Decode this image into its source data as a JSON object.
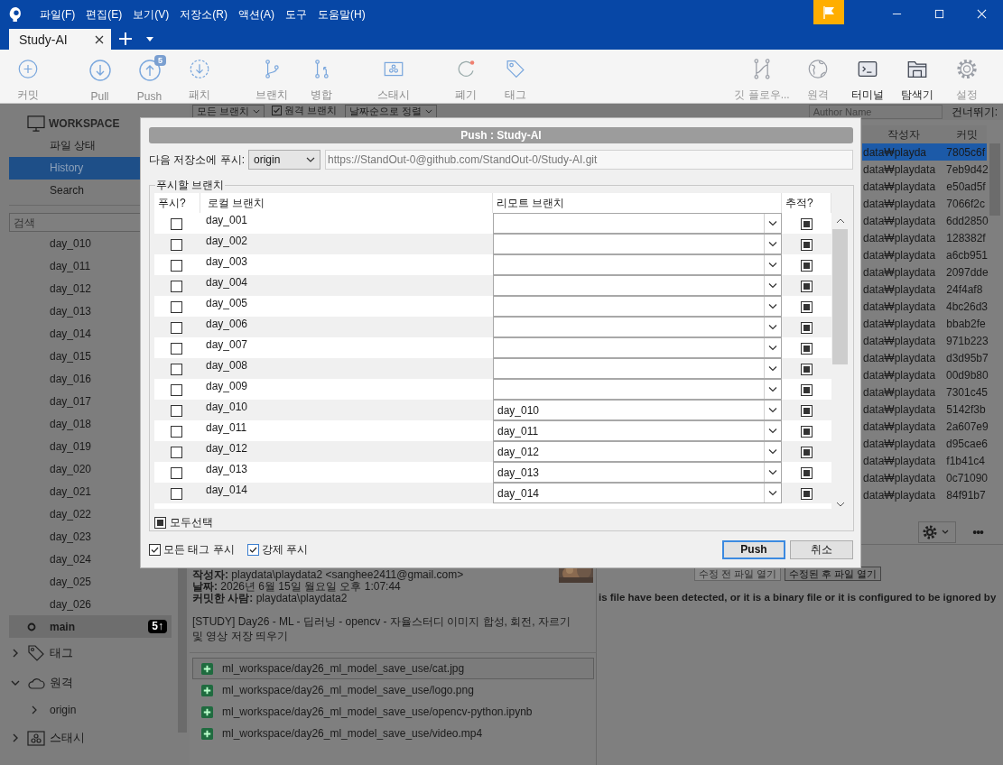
{
  "window": {
    "menus": [
      "파일(F)",
      "편집(E)",
      "보기(V)",
      "저장소(R)",
      "액션(A)",
      "도구",
      "도움말(H)"
    ]
  },
  "tabs": [
    {
      "label": "Study-AI",
      "selected": true
    }
  ],
  "toolbar": {
    "tools": [
      {
        "kind": "add",
        "label": "커밋"
      },
      {
        "kind": "pull",
        "label": "Pull"
      },
      {
        "kind": "push",
        "label": "Push",
        "badge": "5"
      },
      {
        "kind": "patch",
        "label": "패치"
      },
      {
        "kind": "branch",
        "label": "브랜치"
      },
      {
        "kind": "merge",
        "label": "병합"
      },
      {
        "kind": "stash",
        "label": "스태시"
      },
      {
        "kind": "discard",
        "label": "폐기"
      },
      {
        "kind": "tag",
        "label": "태그"
      }
    ],
    "right_tools": [
      {
        "kind": "flow",
        "label": "깃 플로우...",
        "disabled": true
      },
      {
        "kind": "globe",
        "label": "원격",
        "disabled": true
      },
      {
        "kind": "terminal",
        "label": "터미널",
        "disabled": false
      },
      {
        "kind": "folder",
        "label": "탐색기",
        "disabled": false
      },
      {
        "kind": "gear",
        "label": "설정",
        "disabled": true
      }
    ]
  },
  "sidebar": {
    "workspace": "WORKSPACE",
    "views": [
      {
        "label": "파일 상태",
        "selected": false
      },
      {
        "label": "History",
        "selected": true
      },
      {
        "label": "Search",
        "selected": false
      }
    ],
    "search": {
      "placeholder": "검색"
    },
    "branches": [
      {
        "label": "day_010",
        "selected": false
      },
      {
        "label": "day_011",
        "selected": false
      },
      {
        "label": "day_012",
        "selected": false
      },
      {
        "label": "day_013",
        "selected": false
      },
      {
        "label": "day_014",
        "selected": false
      },
      {
        "label": "day_015",
        "selected": false
      },
      {
        "label": "day_016",
        "selected": false
      },
      {
        "label": "day_017",
        "selected": false
      },
      {
        "label": "day_018",
        "selected": false
      },
      {
        "label": "day_019",
        "selected": false
      },
      {
        "label": "day_020",
        "selected": false
      },
      {
        "label": "day_021",
        "selected": false
      },
      {
        "label": "day_022",
        "selected": false
      },
      {
        "label": "day_023",
        "selected": false
      },
      {
        "label": "day_024",
        "selected": false
      },
      {
        "label": "day_025",
        "selected": false
      },
      {
        "label": "day_026",
        "selected": false
      },
      {
        "label": "main",
        "selected": true,
        "badge": "5↑"
      }
    ],
    "sections": [
      {
        "kind": "tag",
        "label": "태그",
        "expanded": false
      },
      {
        "kind": "cloud",
        "label": "원격",
        "expanded": true,
        "children": [
          {
            "label": "origin",
            "expanded": false
          }
        ]
      },
      {
        "kind": "stash",
        "label": "스태시",
        "expanded": false
      }
    ]
  },
  "filters": {
    "branch_select": "모든 브랜치",
    "remote_branches": {
      "label": "원격 브랜치",
      "checked": true
    },
    "sort_select": "날짜순으로 정렬",
    "author": {
      "placeholder": "Author Name"
    },
    "skip_label": "건너뛰기:"
  },
  "commits": {
    "columns": [
      "작성자",
      "커밋"
    ],
    "rows": [
      {
        "author": "data₩playda",
        "hash": "7805c6f",
        "selected": true
      },
      {
        "author": "data₩playdata",
        "hash": "7eb9d42",
        "selected": false
      },
      {
        "author": "data₩playdata",
        "hash": "e50ad5f",
        "selected": false
      },
      {
        "author": "data₩playdata",
        "hash": "7066f2c",
        "selected": false
      },
      {
        "author": "data₩playdata",
        "hash": "6dd2850",
        "selected": false
      },
      {
        "author": "data₩playdata",
        "hash": "128382f",
        "selected": false
      },
      {
        "author": "data₩playdata",
        "hash": "a6cb951",
        "selected": false
      },
      {
        "author": "data₩playdata",
        "hash": "2097dde",
        "selected": false
      },
      {
        "author": "data₩playdata",
        "hash": "24f4af8",
        "selected": false
      },
      {
        "author": "data₩playdata",
        "hash": "4bc26d3",
        "selected": false
      },
      {
        "author": "data₩playdata",
        "hash": "bbab2fe",
        "selected": false
      },
      {
        "author": "data₩playdata",
        "hash": "971b223",
        "selected": false
      },
      {
        "author": "data₩playdata",
        "hash": "d3d95b7",
        "selected": false
      },
      {
        "author": "data₩playdata",
        "hash": "00d9b80",
        "selected": false
      },
      {
        "author": "data₩playdata",
        "hash": "7301c45",
        "selected": false
      },
      {
        "author": "data₩playdata",
        "hash": "5142f3b",
        "selected": false
      },
      {
        "author": "data₩playdata",
        "hash": "2a607e9",
        "selected": false
      },
      {
        "author": "data₩playdata",
        "hash": "d95cae6",
        "selected": false
      },
      {
        "author": "data₩playdata",
        "hash": "f1b41c4",
        "selected": false
      },
      {
        "author": "data₩playdata",
        "hash": "0c71090",
        "selected": false
      },
      {
        "author": "data₩playdata",
        "hash": "84f91b7",
        "selected": false
      }
    ]
  },
  "details": {
    "lines": [
      "**작성자:** playdata\\playdata2 <sanghee2411@gmail.com>",
      "**날짜:** 2026년 6월 15일 월요일 오후 1:07:44",
      "**커밋한 사람:** playdata\\playdata2"
    ],
    "message": "[STUDY] Day26 - ML - 딥러닝 - opencv - 자율스터디 이미지 합성, 회전, 자르기 및 영상 저장 띄우기",
    "files": [
      {
        "path": "ml_workspace/day26_ml_model_save_use/cat.jpg",
        "selected": true
      },
      {
        "path": "ml_workspace/day26_ml_model_save_use/logo.png",
        "selected": false
      },
      {
        "path": "ml_workspace/day26_ml_model_save_use/opencv-python.ipynb",
        "selected": false
      },
      {
        "path": "ml_workspace/day26_ml_model_save_use/video.mp4",
        "selected": false
      }
    ]
  },
  "diff": {
    "more": "•••",
    "buttons": [
      {
        "label": "수정 전 파일 열기",
        "disabled": true
      },
      {
        "label": "수정된 후 파일 열기",
        "disabled": false
      }
    ],
    "notice": "is file have been detected, or it is a binary file or it is configured to be ignored by"
  },
  "dialog": {
    "title": "Push : Study-AI",
    "remote_label": "다음 저장소에 푸시:",
    "remote": "origin",
    "url": "https://StandOut-0@github.com/StandOut-0/Study-AI.git",
    "group": "푸시할 브랜치",
    "columns": [
      "푸시?",
      "로컬 브랜치",
      "리모트 브랜치",
      "추적?"
    ],
    "rows": [
      {
        "push": false,
        "local": "day_001",
        "track": true
      },
      {
        "push": false,
        "local": "day_002",
        "track": true
      },
      {
        "push": false,
        "local": "day_003",
        "track": true
      },
      {
        "push": false,
        "local": "day_004",
        "track": true
      },
      {
        "push": false,
        "local": "day_005",
        "track": true
      },
      {
        "push": false,
        "local": "day_006",
        "track": true
      },
      {
        "push": false,
        "local": "day_007",
        "track": true
      },
      {
        "push": false,
        "local": "day_008",
        "track": true
      },
      {
        "push": false,
        "local": "day_009",
        "track": true
      },
      {
        "push": false,
        "local": "day_010",
        "remote": "day_010",
        "track": true
      },
      {
        "push": false,
        "local": "day_011",
        "remote": "day_011",
        "track": true
      },
      {
        "push": false,
        "local": "day_012",
        "remote": "day_012",
        "track": true
      },
      {
        "push": false,
        "local": "day_013",
        "remote": "day_013",
        "track": true
      },
      {
        "push": false,
        "local": "day_014",
        "remote": "day_014",
        "track": true
      }
    ],
    "select_all": {
      "label": "모두선택",
      "checked": true
    },
    "options": [
      {
        "label": "모든 태그 푸시",
        "checked": true
      },
      {
        "label": "강제 푸시",
        "checked": true
      }
    ],
    "buttons": [
      {
        "label": "Push",
        "default": true
      },
      {
        "label": "취소",
        "default": false
      }
    ]
  }
}
